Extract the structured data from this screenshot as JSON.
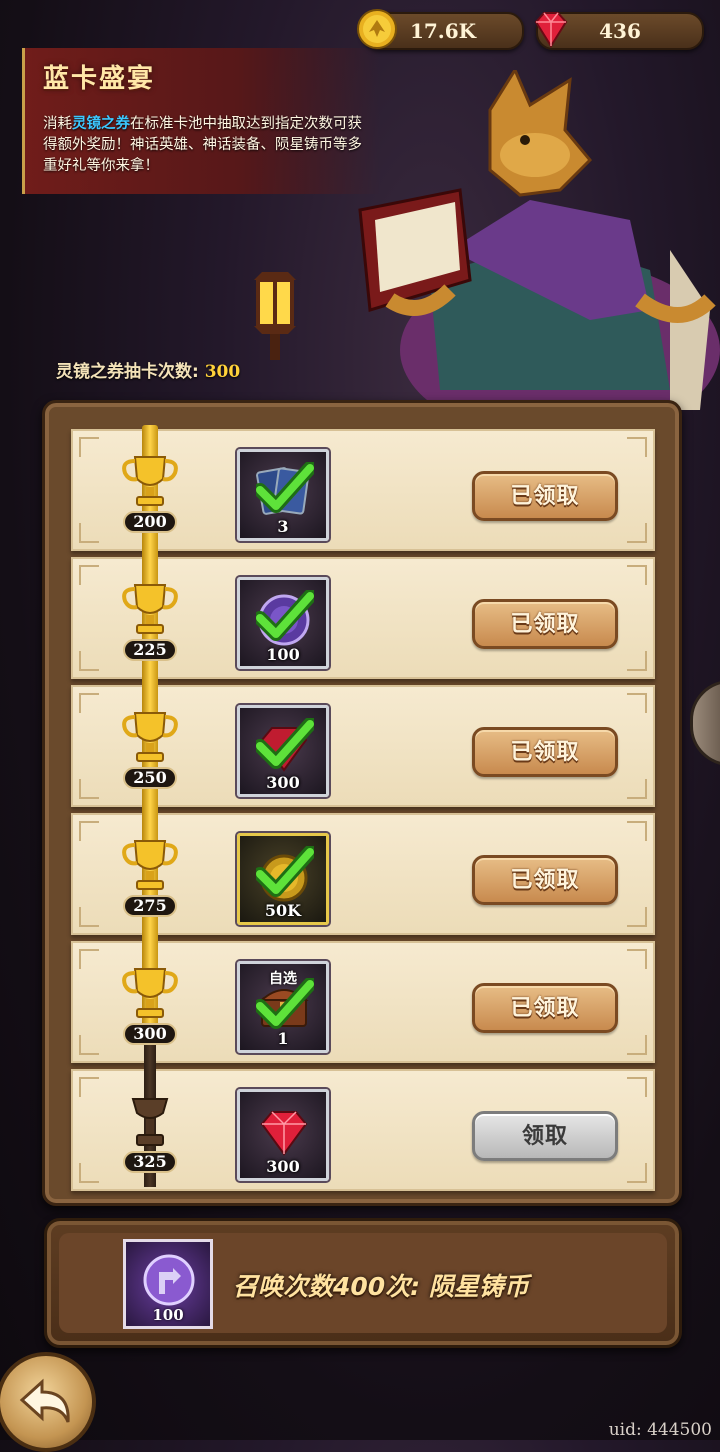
{
  "resources": {
    "coins": "17.6K",
    "gems": "436"
  },
  "header": {
    "title": "蓝卡盛宴",
    "desc_part1": "消耗",
    "desc_highlight": "灵镜之券",
    "desc_part2": "在标准卡池中抽取达到指定次数可获得额外奖励！神话英雄、神话装备、陨星铸币等多重好礼等你来拿！"
  },
  "count": {
    "label": "灵镜之券抽卡次数: ",
    "value": "300"
  },
  "milestones": [
    {
      "threshold": "200",
      "reward_icon": "card-pack-icon",
      "qty": "3",
      "button": "已领取",
      "claimed": true
    },
    {
      "threshold": "225",
      "reward_icon": "meteor-coin-icon",
      "qty": "100",
      "button": "已领取",
      "claimed": true
    },
    {
      "threshold": "250",
      "reward_icon": "ruby-icon",
      "qty": "300",
      "button": "已领取",
      "claimed": true
    },
    {
      "threshold": "275",
      "reward_icon": "gold-coin-icon",
      "qty": "50K",
      "button": "已领取",
      "claimed": true
    },
    {
      "threshold": "300",
      "reward_icon": "chest-icon",
      "tag": "自选",
      "qty": "1",
      "button": "已领取",
      "claimed": true
    },
    {
      "threshold": "325",
      "reward_icon": "ruby-icon",
      "qty": "300",
      "button": "领取",
      "claimed": false
    }
  ],
  "progress": {
    "reached_milestones": 5,
    "total_milestones": 6
  },
  "bottom": {
    "qty": "100",
    "text": "召唤次数400次: 陨星铸币"
  },
  "uid": "uid: 444500",
  "colors": {
    "claimed_button": "#d9a266",
    "claim_button": "#cfcfcf",
    "highlight": "#3cc8ff",
    "progress_gold": "#ffd44a"
  }
}
